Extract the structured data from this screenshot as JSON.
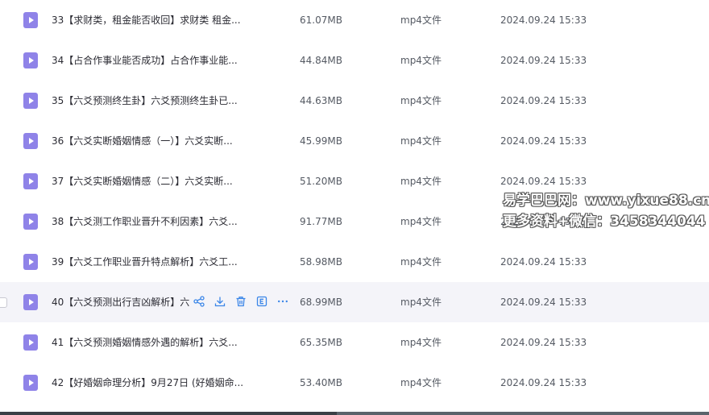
{
  "rows": [
    {
      "name": "33【求财类，租金能否收回】求财类 租金...",
      "size": "61.07MB",
      "type": "mp4文件",
      "date": "2024.09.24 15:33"
    },
    {
      "name": "34【占合作事业能否成功】占合作事业能...",
      "size": "44.84MB",
      "type": "mp4文件",
      "date": "2024.09.24 15:33"
    },
    {
      "name": "35【六爻预测终生卦】六爻预测终生卦已...",
      "size": "44.63MB",
      "type": "mp4文件",
      "date": "2024.09.24 15:33"
    },
    {
      "name": "36【六爻实断婚姻情感（一）】六爻实断...",
      "size": "45.99MB",
      "type": "mp4文件",
      "date": "2024.09.24 15:33"
    },
    {
      "name": "37【六爻实断婚姻情感（二）】六爻实断...",
      "size": "51.20MB",
      "type": "mp4文件",
      "date": "2024.09.24 15:33"
    },
    {
      "name": "38【六爻测工作职业晋升不利因素】六爻...",
      "size": "91.77MB",
      "type": "mp4文件",
      "date": "2024.09.24 15:33"
    },
    {
      "name": "39【六爻工作职业晋升特点解析】六爻工...",
      "size": "58.98MB",
      "type": "mp4文件",
      "date": "2024.09.24 15:33"
    },
    {
      "name": "40【六爻预测出行吉凶解析】六",
      "size": "68.99MB",
      "type": "mp4文件",
      "date": "2024.09.24 15:33"
    },
    {
      "name": "41【六爻预测婚姻情感外遇的解析】六爻...",
      "size": "65.35MB",
      "type": "mp4文件",
      "date": "2024.09.24 15:33"
    },
    {
      "name": "42【好婚姻命理分析】9月27日 (好婚姻命...",
      "size": "53.40MB",
      "type": "mp4文件",
      "date": "2024.09.24 15:33"
    }
  ],
  "actions": [
    "share-icon",
    "download-icon",
    "delete-icon",
    "extract-icon",
    "more-icon"
  ],
  "watermark": {
    "line1": "易学巴巴网：www.yixue88.cn",
    "line2": "更多资料+微信：3458344044"
  },
  "colors": {
    "icon": "#8f83e8",
    "action": "#3b86e8",
    "hover_row": "#f4f4f9"
  }
}
